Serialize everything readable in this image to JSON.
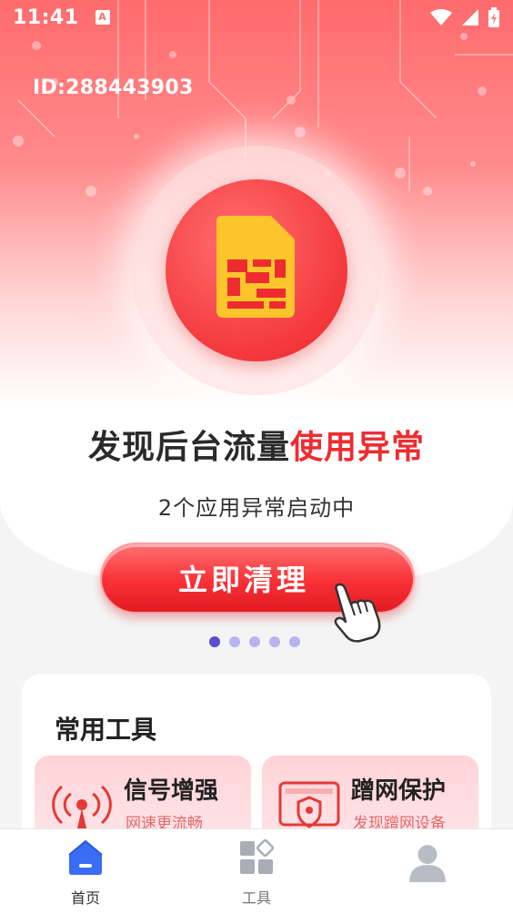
{
  "status_bar": {
    "time": "11:41",
    "notification_icon": "a-app-icon"
  },
  "user": {
    "id_text": "ID:288443903"
  },
  "hero": {
    "headline_normal": "发现后台流量",
    "headline_accent": "使用异常",
    "subline": "2个应用异常启动中",
    "clean_button_label": "立即清理",
    "carousel_pages": 5,
    "carousel_active_index": 0
  },
  "tools": {
    "title": "常用工具",
    "items": [
      {
        "name": "信号增强",
        "desc": "网速更流畅",
        "icon": "signal-tower-icon"
      },
      {
        "name": "蹭网保护",
        "desc": "发现蹭网设备",
        "icon": "shield-device-icon"
      }
    ]
  },
  "bottom_nav": {
    "items": [
      {
        "label": "首页",
        "icon": "home-icon",
        "active": true
      },
      {
        "label": "工具",
        "icon": "tools-grid-icon",
        "active": false
      },
      {
        "label": "",
        "icon": "profile-icon",
        "active": false
      }
    ]
  },
  "colors": {
    "accent": "#ee2c30",
    "nav_active": "#3a6cf5",
    "dot_active": "#5a4bd1"
  }
}
